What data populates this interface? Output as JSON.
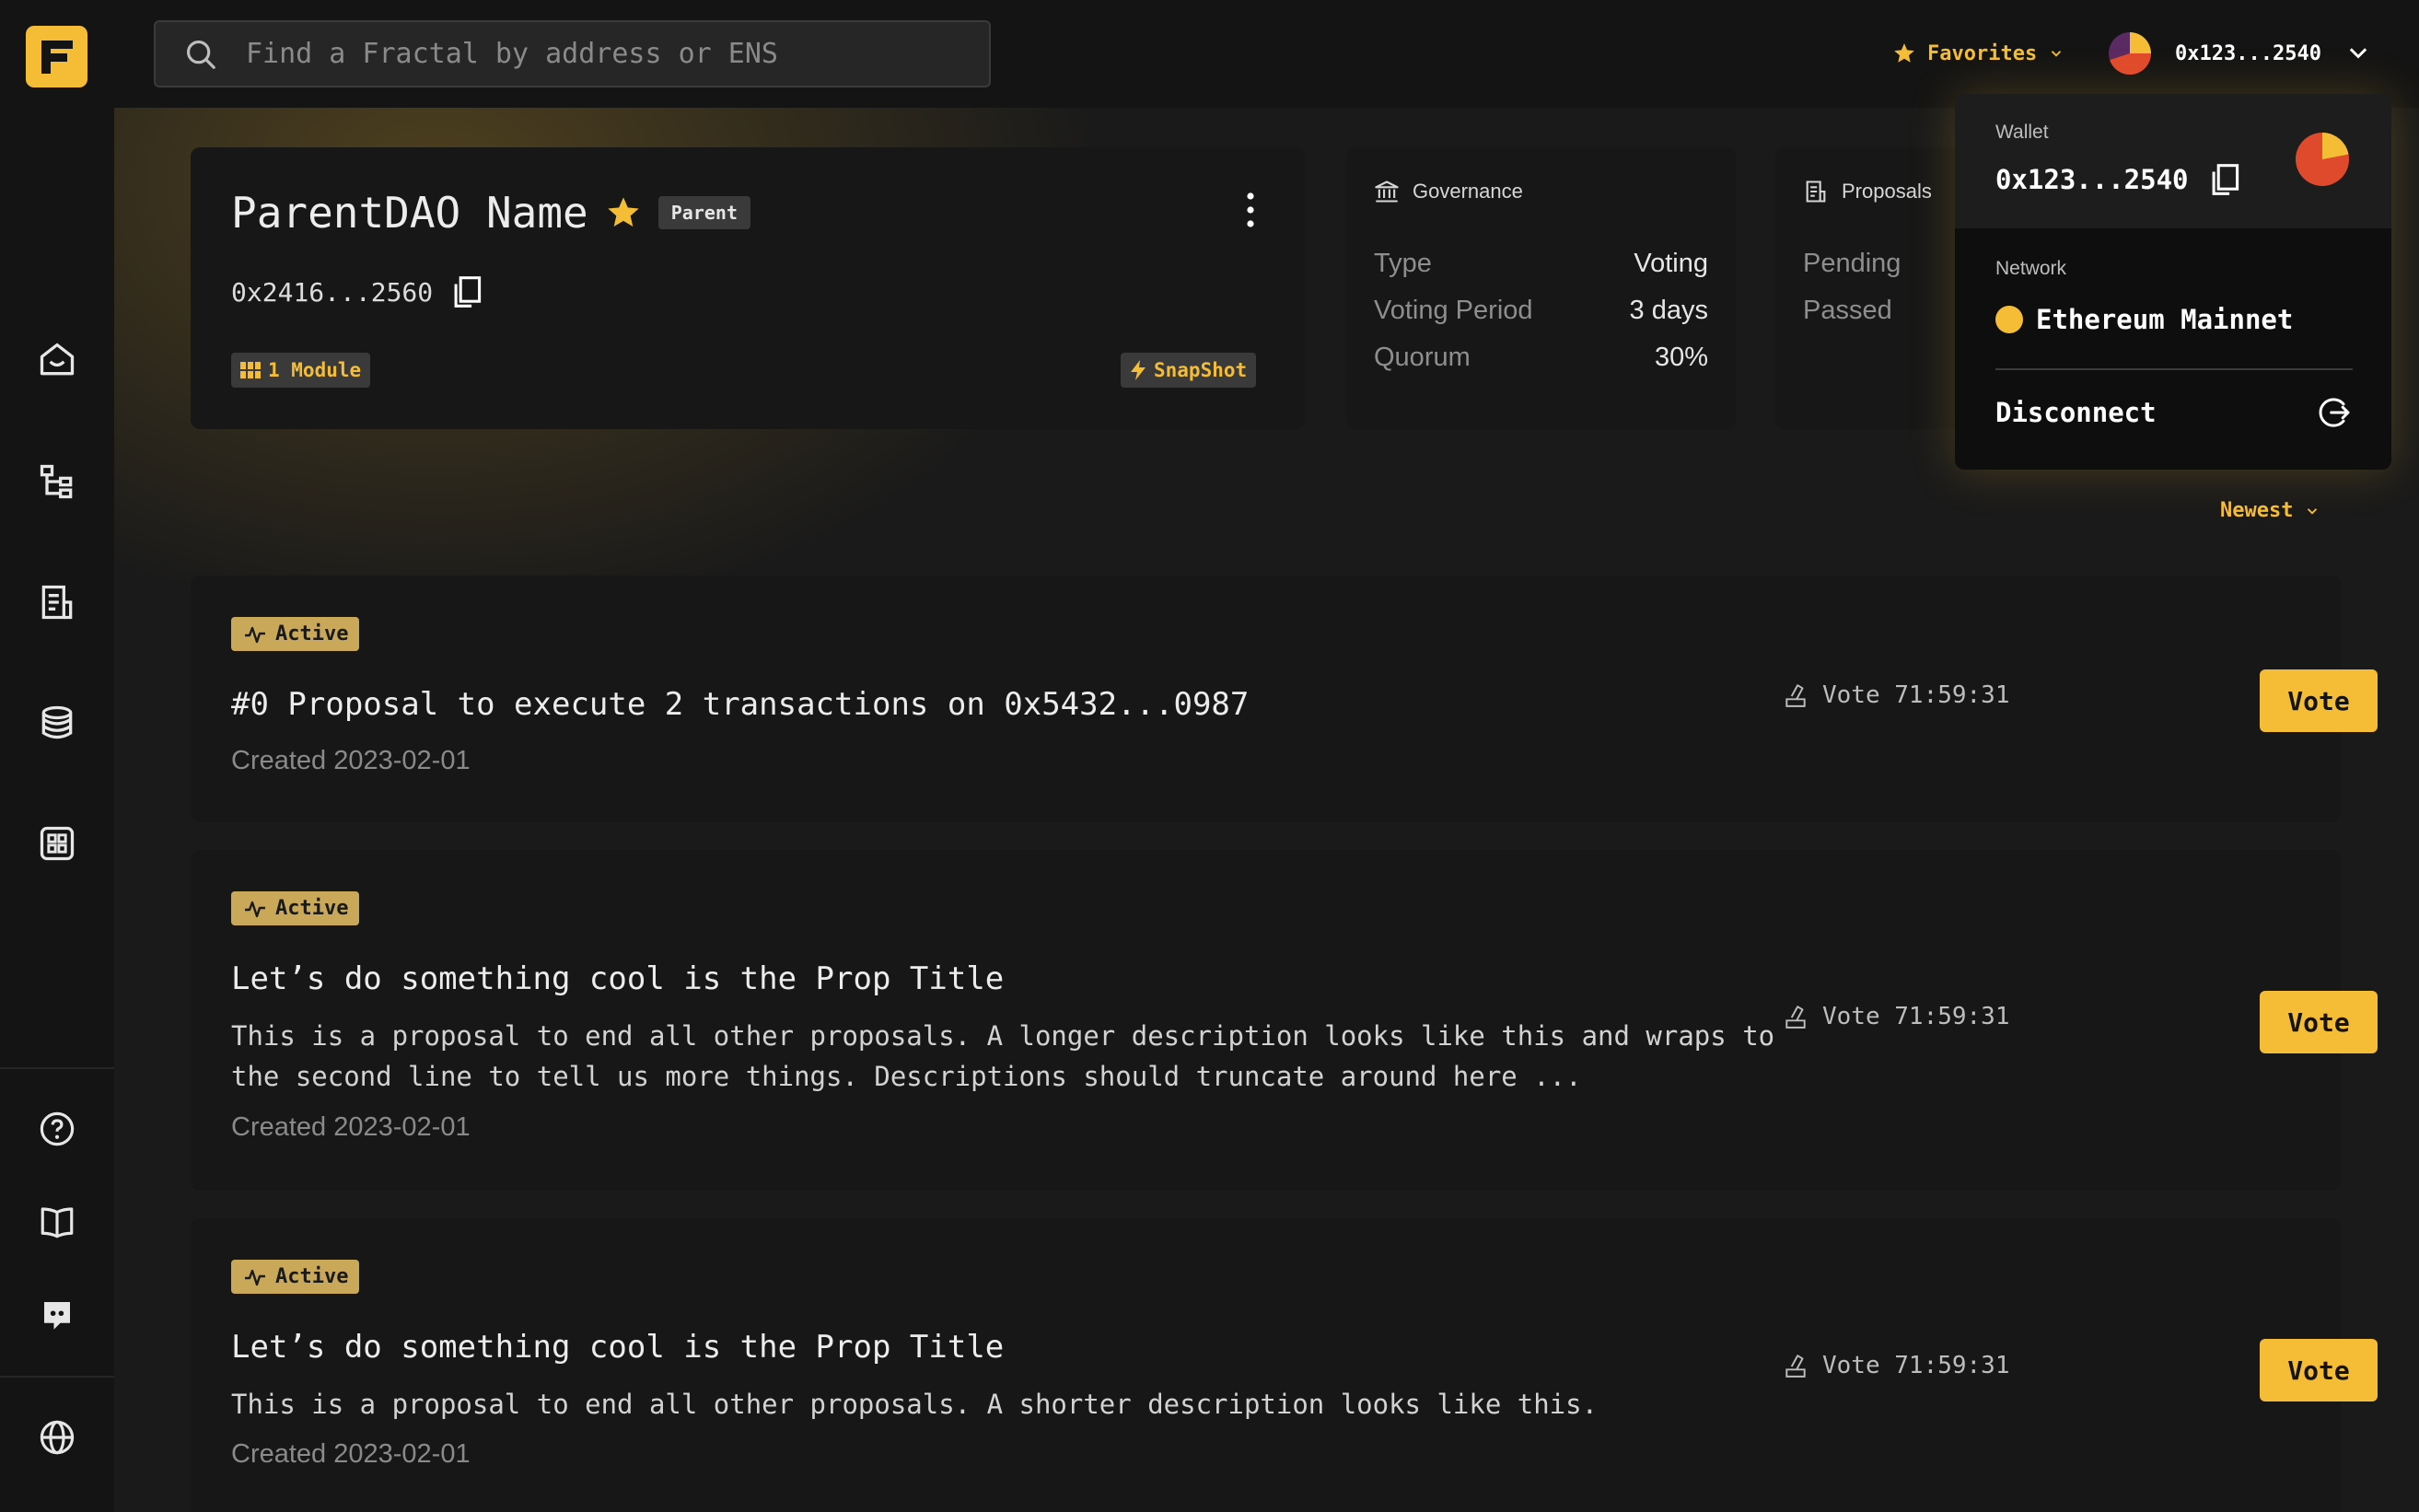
{
  "colors": {
    "accent": "#f5bd36",
    "badge": "#c9a959",
    "bg": "#1a1a1a",
    "panel": "#171717"
  },
  "topbar": {
    "logo_letter": "F",
    "search_placeholder": "Find a Fractal by address or ENS",
    "favorites_label": "Favorites",
    "account_address": "0x123...2540"
  },
  "sidebar": {
    "items": [
      "home-icon",
      "hierarchy-icon",
      "proposals-icon",
      "treasury-icon",
      "modules-icon"
    ],
    "footer": [
      "help-icon",
      "docs-icon",
      "discord-icon",
      "globe-icon"
    ]
  },
  "dao": {
    "name": "ParentDAO Name",
    "role_chip": "Parent",
    "address": "0x2416...2560",
    "modules_label": "1 Module",
    "snapshot_label": "SnapShot"
  },
  "governance": {
    "heading": "Governance",
    "rows": [
      {
        "key": "Type",
        "value": "Voting"
      },
      {
        "key": "Voting Period",
        "value": "3 days"
      },
      {
        "key": "Quorum",
        "value": "30%"
      }
    ]
  },
  "proposals_summary": {
    "heading": "Proposals",
    "rows": [
      {
        "key": "Pending"
      },
      {
        "key": "Passed"
      }
    ]
  },
  "sort": {
    "label": "Newest"
  },
  "proposals": [
    {
      "status": "Active",
      "title": "#0 Proposal to execute 2 transactions on 0x5432...0987",
      "description": "",
      "created": "Created 2023-02-01",
      "timer": "Vote 71:59:31",
      "action": "Vote"
    },
    {
      "status": "Active",
      "title": "Let’s do something cool is the Prop Title",
      "description": "This is a proposal to end all other proposals. A longer description looks like this and wraps to the second line to tell us more things. Descriptions should truncate around here ...",
      "created": "Created 2023-02-01",
      "timer": "Vote 71:59:31",
      "action": "Vote"
    },
    {
      "status": "Active",
      "title": "Let’s do something cool is the Prop Title",
      "description": "This is a proposal to end all other proposals. A shorter description looks like this.",
      "created": "Created 2023-02-01",
      "timer": "Vote 71:59:31",
      "action": "Vote"
    }
  ],
  "wallet_menu": {
    "wallet_label": "Wallet",
    "address": "0x123...2540",
    "network_label": "Network",
    "network_name": "Ethereum Mainnet",
    "disconnect_label": "Disconnect"
  }
}
